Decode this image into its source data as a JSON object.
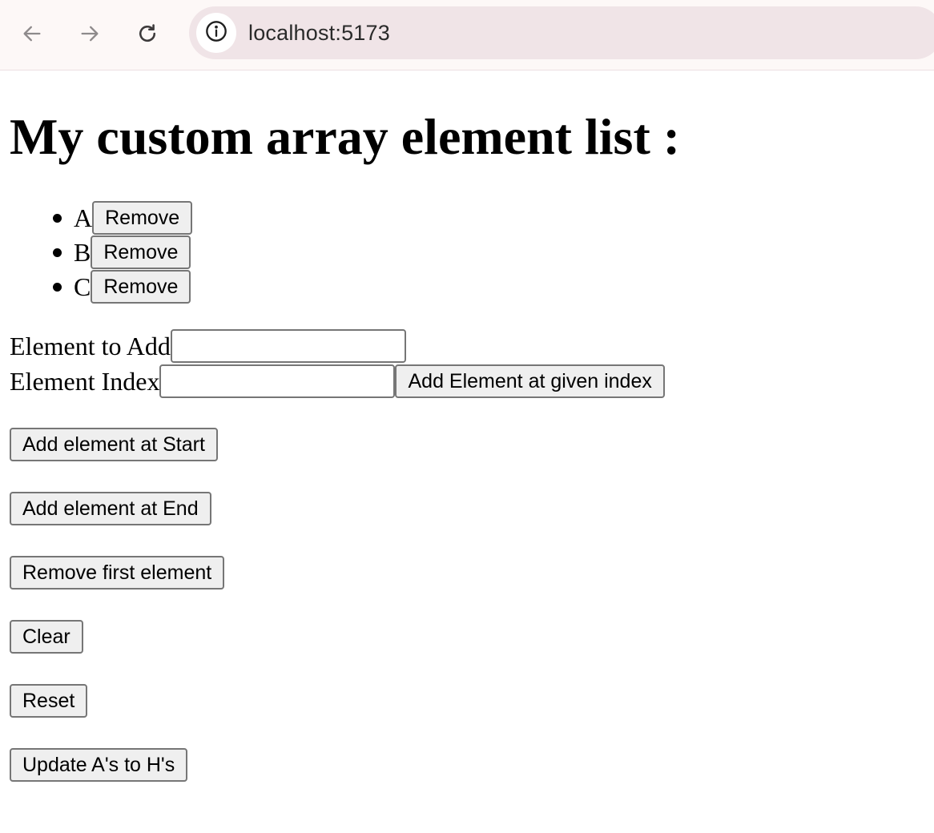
{
  "browser": {
    "url": "localhost:5173",
    "back_icon": "arrow-left-icon",
    "forward_icon": "arrow-right-icon",
    "reload_icon": "reload-icon",
    "site_info_icon": "info-icon"
  },
  "page": {
    "title": "My custom array element list :",
    "items": [
      {
        "label": "A",
        "remove_label": "Remove"
      },
      {
        "label": "B",
        "remove_label": "Remove"
      },
      {
        "label": "C",
        "remove_label": "Remove"
      }
    ],
    "form": {
      "element_label": "Element to Add",
      "element_value": "",
      "index_label": "Element Index",
      "index_value": "",
      "add_at_index_label": "Add Element at given index"
    },
    "actions": {
      "add_start": "Add element at Start",
      "add_end": "Add element at End",
      "remove_first": "Remove first element",
      "clear": "Clear",
      "reset": "Reset",
      "update": "Update A's to H's"
    }
  },
  "colors": {
    "toolbar_bg": "#fdf8f7",
    "address_bar_bg": "#f0e4e7",
    "button_bg": "#efefef",
    "button_border": "#767676"
  }
}
